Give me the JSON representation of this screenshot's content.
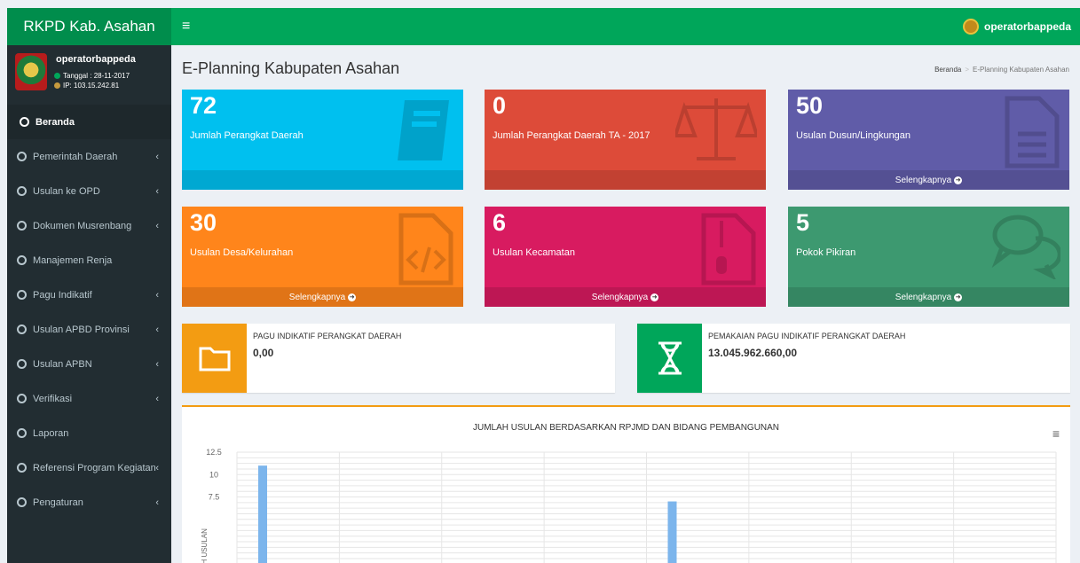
{
  "app": {
    "brand": "RKPD Kab. Asahan"
  },
  "header": {
    "menu_icon": "hamburger-icon",
    "user": "operatorbappeda"
  },
  "sidebar": {
    "user": {
      "name": "operatorbappeda",
      "date": "Tanggal : 28-11-2017",
      "ip": "IP: 103.15.242.81"
    },
    "items": [
      {
        "label": "Beranda",
        "active": true,
        "submenu": false
      },
      {
        "label": "Pemerintah Daerah",
        "submenu": true
      },
      {
        "label": "Usulan ke OPD",
        "submenu": true
      },
      {
        "label": "Dokumen Musrenbang",
        "submenu": true
      },
      {
        "label": "Manajemen Renja",
        "submenu": false
      },
      {
        "label": "Pagu Indikatif",
        "submenu": true
      },
      {
        "label": "Usulan APBD Provinsi",
        "submenu": true
      },
      {
        "label": "Usulan APBN",
        "submenu": true
      },
      {
        "label": "Verifikasi",
        "submenu": true
      },
      {
        "label": "Laporan",
        "submenu": false
      },
      {
        "label": "Referensi Program Kegiatan",
        "submenu": true
      },
      {
        "label": "Pengaturan",
        "submenu": true
      }
    ]
  },
  "page": {
    "title": "E-Planning Kabupaten Asahan",
    "breadcrumb": {
      "home": "Beranda",
      "separator": ">",
      "current": "E-Planning Kabupaten Asahan"
    }
  },
  "stat_boxes": [
    {
      "value": "72",
      "label": "Jumlah Perangkat Daerah",
      "footer": "",
      "color": "#00c0ef",
      "icon": "book-icon"
    },
    {
      "value": "0",
      "label": "Jumlah Perangkat Daerah TA - 2017",
      "footer": "",
      "color": "#dd4b39",
      "icon": "balance-scale-icon"
    },
    {
      "value": "50",
      "label": "Usulan Dusun/Lingkungan",
      "footer": "Selengkapnya",
      "color": "#605ca8",
      "icon": "file-text-icon"
    },
    {
      "value": "30",
      "label": "Usulan Desa/Kelurahan",
      "footer": "Selengkapnya",
      "color": "#ff851b",
      "icon": "file-code-icon"
    },
    {
      "value": "6",
      "label": "Usulan Kecamatan",
      "footer": "Selengkapnya",
      "color": "#d81b60",
      "icon": "file-zip-icon"
    },
    {
      "value": "5",
      "label": "Pokok Pikiran",
      "footer": "Selengkapnya",
      "color": "#3d9970",
      "icon": "comments-icon"
    }
  ],
  "info_boxes": [
    {
      "title": "PAGU INDIKATIF PERANGKAT DAERAH",
      "value": "0,00",
      "icon": "folder-icon",
      "color": "#f39c12"
    },
    {
      "title": "PEMAKAIAN PAGU INDIKATIF PERANGKAT DAERAH",
      "value": "13.045.962.660,00",
      "icon": "hourglass-icon",
      "color": "#00a65a"
    }
  ],
  "chart_data": {
    "type": "bar",
    "title": "JUMLAH USULAN BERDASARKAN RPJMD DAN BIDANG PEMBANGUNAN",
    "ylabel": "AH USULAN",
    "ylim": [
      0,
      12.5
    ],
    "yticks": [
      "12.5",
      "10",
      "7.5"
    ],
    "series": [
      {
        "values": [
          11,
          0,
          0,
          0,
          7,
          0,
          0,
          0
        ]
      }
    ],
    "bar_color": "#7cb5ec",
    "grid": true,
    "menu_icon": "hamburger-icon"
  }
}
